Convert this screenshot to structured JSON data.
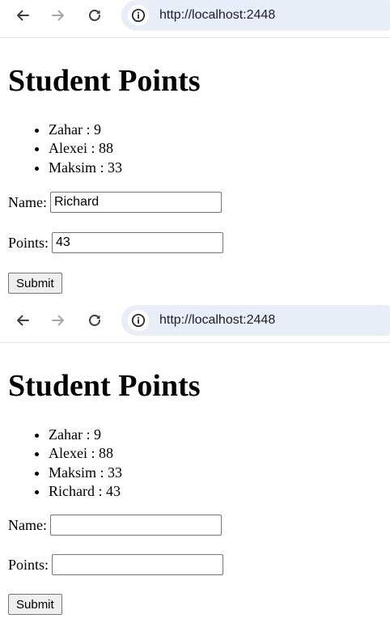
{
  "frames": [
    {
      "browser": {
        "url": "http://localhost:2448"
      },
      "page": {
        "title": "Student Points",
        "students": [
          "Zahar : 9",
          "Alexei : 88",
          "Maksim : 33"
        ],
        "form": {
          "name_label": "Name:",
          "name_value": "Richard",
          "points_label": "Points:",
          "points_value": "43",
          "submit_label": "Submit"
        }
      }
    },
    {
      "browser": {
        "url": "http://localhost:2448"
      },
      "page": {
        "title": "Student Points",
        "students": [
          "Zahar : 9",
          "Alexei : 88",
          "Maksim : 33",
          "Richard : 43"
        ],
        "form": {
          "name_label": "Name:",
          "name_value": "",
          "points_label": "Points:",
          "points_value": "",
          "submit_label": "Submit"
        }
      }
    }
  ],
  "icons": {
    "back": "arrow-left-icon",
    "forward": "arrow-right-icon",
    "reload": "reload-icon",
    "site_info": "info-icon"
  },
  "colors": {
    "omnibox_bg": "#e9edf7",
    "icon_active": "#3c4043",
    "icon_disabled": "#a3a6ab"
  }
}
